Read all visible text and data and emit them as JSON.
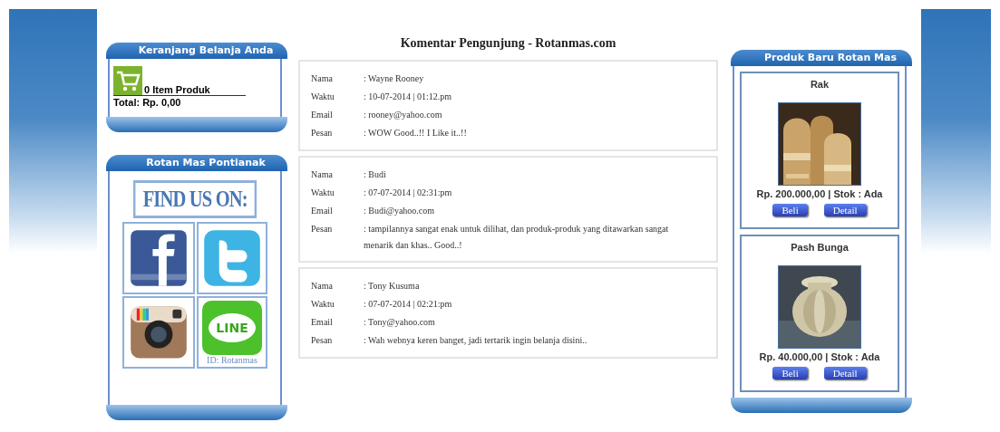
{
  "cart": {
    "title": "Keranjang Belanja Anda",
    "count": "0 Item Produk",
    "total": "Total: Rp. 0,00"
  },
  "social": {
    "title": "Rotan Mas Pontianak",
    "banner": "FIND US ON:",
    "line_label": "LINE",
    "line_id": "ID: Rotanmas"
  },
  "page_title": "Komentar Pengunjung - Rotanmas.com",
  "comments": [
    {
      "fields": [
        {
          "label": "Nama",
          "value": ": Wayne Rooney"
        },
        {
          "label": "Waktu",
          "value": ": 10-07-2014 | 01:12.pm"
        },
        {
          "label": "Email",
          "value": ": rooney@yahoo.com"
        },
        {
          "label": "Pesan",
          "value": ": WOW Good..!! I Like it..!!"
        }
      ]
    },
    {
      "fields": [
        {
          "label": "Nama",
          "value": ": Budi"
        },
        {
          "label": "Waktu",
          "value": ": 07-07-2014 | 02:31:pm"
        },
        {
          "label": "Email",
          "value": ": Budi@yahoo.com"
        },
        {
          "label": "Pesan",
          "value": ": tampilannya sangat enak untuk dilihat, dan produk-produk yang ditawarkan sangat menarik dan khas.. Good..!"
        }
      ]
    },
    {
      "fields": [
        {
          "label": "Nama",
          "value": ": Tony Kusuma"
        },
        {
          "label": "Waktu",
          "value": ": 07-07-2014 | 02:21:pm"
        },
        {
          "label": "Email",
          "value": ": Tony@yahoo.com"
        },
        {
          "label": "Pesan",
          "value": ": Wah webnya keren banget, jadi tertarik ingin belanja disini.."
        }
      ]
    }
  ],
  "products": {
    "title": "Produk Baru Rotan Mas",
    "items": [
      {
        "name": "Rak",
        "price": "Rp. 200.000,00 | Stok : Ada",
        "buttons": [
          "Beli",
          "Detail"
        ],
        "kind": "picture"
      },
      {
        "name": "Pash Bunga",
        "price": "Rp. 40.000,00 | Stok : Ada",
        "buttons": [
          "Beli",
          "Detail"
        ],
        "kind": "picture"
      }
    ]
  }
}
